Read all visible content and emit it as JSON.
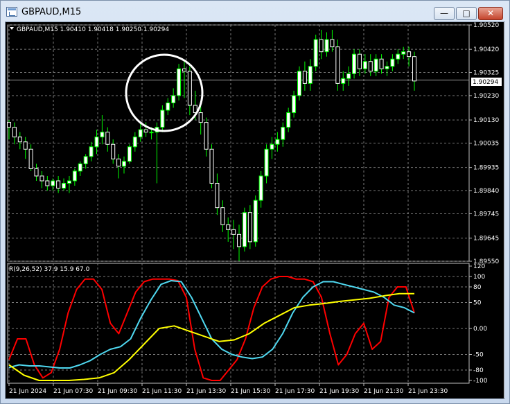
{
  "window": {
    "title": "GBPAUD,M15",
    "minimize": "—",
    "maximize": "□",
    "close": "✕"
  },
  "chart": {
    "info": "GBPAUD,M15  1.90410 1.90418 1.90250 1.90294",
    "current_price": "1.90294",
    "price_ticks": [
      "1.90520",
      "1.90420",
      "1.90325",
      "1.90230",
      "1.90130",
      "1.90035",
      "1.89935",
      "1.89840",
      "1.89745",
      "1.89645",
      "1.89550"
    ],
    "time_ticks": [
      "21 Jun 2024",
      "21 Jun 07:30",
      "21 Jun 09:30",
      "21 Jun 11:30",
      "21 Jun 13:30",
      "21 Jun 15:30",
      "21 Jun 17:30",
      "21 Jun 19:30",
      "21 Jun 21:30",
      "21 Jun 23:30"
    ],
    "indicator_label": "R(9,26,52) 37.9 15.9 67.0",
    "indicator_ticks": [
      "120",
      "100",
      "80",
      "50",
      "0.00",
      "-50",
      "-80",
      "-100"
    ],
    "colors": {
      "background": "#000000",
      "bull": "#ffffff",
      "bear": "#ffffff",
      "wick": "#00ff00",
      "grid": "#7a7a7a",
      "red": "#ff0000",
      "cyan": "#4fd8f0",
      "yellow": "#ffff00",
      "annotation": "#ffffff"
    }
  },
  "chart_data": [
    {
      "type": "candlestick",
      "title": "GBPAUD,M15",
      "ylim": [
        1.8955,
        1.9052
      ],
      "series": [
        {
          "name": "GBPAUD",
          "ohlc": [
            [
              1.9012,
              1.9013,
              1.9005,
              1.901
            ],
            [
              1.901,
              1.9012,
              1.9003,
              1.9006
            ],
            [
              1.9006,
              1.9008,
              1.9001,
              1.9004
            ],
            [
              1.9004,
              1.9006,
              1.8997,
              1.9001
            ],
            [
              1.9001,
              1.9003,
              1.8992,
              1.8993
            ],
            [
              1.8993,
              1.8995,
              1.8988,
              1.899
            ],
            [
              1.899,
              1.8992,
              1.8985,
              1.8988
            ],
            [
              1.8988,
              1.899,
              1.8984,
              1.8986
            ],
            [
              1.8986,
              1.8989,
              1.8984,
              1.8988
            ],
            [
              1.8988,
              1.899,
              1.8983,
              1.8985
            ],
            [
              1.8985,
              1.8989,
              1.8984,
              1.8987
            ],
            [
              1.8987,
              1.899,
              1.8983,
              1.8988
            ],
            [
              1.8988,
              1.8993,
              1.8986,
              1.8992
            ],
            [
              1.8992,
              1.8996,
              1.899,
              1.8995
            ],
            [
              1.8995,
              1.8999,
              1.8993,
              1.8998
            ],
            [
              1.8998,
              1.9004,
              1.8996,
              1.9002
            ],
            [
              1.9002,
              1.9009,
              1.8999,
              1.9006
            ],
            [
              1.9006,
              1.9015,
              1.9003,
              1.9008
            ],
            [
              1.9008,
              1.901,
              1.9,
              1.9003
            ],
            [
              1.9003,
              1.9005,
              1.8995,
              1.8997
            ],
            [
              1.8997,
              1.8999,
              1.8989,
              1.8994
            ],
            [
              1.8994,
              1.8998,
              1.8991,
              1.8996
            ],
            [
              1.8996,
              1.9003,
              1.8995,
              1.9002
            ],
            [
              1.9002,
              1.9008,
              1.9,
              1.9006
            ],
            [
              1.9006,
              1.9012,
              1.9004,
              1.9009
            ],
            [
              1.9009,
              1.9012,
              1.9006,
              1.9008
            ],
            [
              1.9008,
              1.901,
              1.9005,
              1.9008
            ],
            [
              1.9008,
              1.9012,
              1.8987,
              1.901
            ],
            [
              1.901,
              1.9019,
              1.9008,
              1.9017
            ],
            [
              1.9017,
              1.9022,
              1.9015,
              1.902
            ],
            [
              1.902,
              1.9026,
              1.9018,
              1.9023
            ],
            [
              1.9023,
              1.9036,
              1.9021,
              1.9034
            ],
            [
              1.9034,
              1.9037,
              1.9022,
              1.9033
            ],
            [
              1.9033,
              1.9035,
              1.9015,
              1.9019
            ],
            [
              1.9019,
              1.9025,
              1.9013,
              1.9016
            ],
            [
              1.9016,
              1.9019,
              1.9007,
              1.9012
            ],
            [
              1.9012,
              1.9014,
              1.8998,
              1.9001
            ],
            [
              1.9001,
              1.9003,
              1.8985,
              1.8987
            ],
            [
              1.8987,
              1.8991,
              1.8974,
              1.8977
            ],
            [
              1.8977,
              1.898,
              1.8967,
              1.897
            ],
            [
              1.897,
              1.8973,
              1.8963,
              1.8968
            ],
            [
              1.8968,
              1.8972,
              1.896,
              1.8966
            ],
            [
              1.8966,
              1.897,
              1.8955,
              1.8961
            ],
            [
              1.8961,
              1.8977,
              1.8959,
              1.8975
            ],
            [
              1.8975,
              1.8978,
              1.896,
              1.8963
            ],
            [
              1.8963,
              1.8982,
              1.8961,
              1.898
            ],
            [
              1.898,
              1.8992,
              1.8977,
              1.899
            ],
            [
              1.899,
              1.9003,
              1.8987,
              1.9001
            ],
            [
              1.9001,
              1.9006,
              1.8997,
              1.9003
            ],
            [
              1.9003,
              1.9008,
              1.9,
              1.9005
            ],
            [
              1.9005,
              1.9012,
              1.9002,
              1.901
            ],
            [
              1.901,
              1.9018,
              1.9008,
              1.9016
            ],
            [
              1.9016,
              1.9025,
              1.9014,
              1.9023
            ],
            [
              1.9023,
              1.9035,
              1.9021,
              1.9033
            ],
            [
              1.9033,
              1.9037,
              1.9025,
              1.9028
            ],
            [
              1.9028,
              1.9038,
              1.9025,
              1.9035
            ],
            [
              1.9035,
              1.9048,
              1.9033,
              1.9046
            ],
            [
              1.9046,
              1.905,
              1.9038,
              1.9041
            ],
            [
              1.9041,
              1.9049,
              1.9039,
              1.9046
            ],
            [
              1.9046,
              1.905,
              1.9041,
              1.9043
            ],
            [
              1.9043,
              1.9046,
              1.9025,
              1.9028
            ],
            [
              1.9028,
              1.9033,
              1.9025,
              1.903
            ],
            [
              1.903,
              1.9035,
              1.9027,
              1.9032
            ],
            [
              1.9032,
              1.9042,
              1.903,
              1.904
            ],
            [
              1.904,
              1.9042,
              1.9031,
              1.9034
            ],
            [
              1.9034,
              1.904,
              1.9032,
              1.9037
            ],
            [
              1.9037,
              1.904,
              1.9031,
              1.9033
            ],
            [
              1.9033,
              1.904,
              1.9031,
              1.9038
            ],
            [
              1.9038,
              1.904,
              1.9032,
              1.9034
            ],
            [
              1.9034,
              1.9037,
              1.9031,
              1.9035
            ],
            [
              1.9035,
              1.904,
              1.9033,
              1.9038
            ],
            [
              1.9038,
              1.9042,
              1.9036,
              1.904
            ],
            [
              1.904,
              1.9043,
              1.9038,
              1.9041
            ],
            [
              1.9041,
              1.9043,
              1.9035,
              1.9039
            ],
            [
              1.9039,
              1.9041,
              1.9025,
              1.9029
            ]
          ]
        }
      ]
    },
    {
      "type": "line",
      "title": "R(9,26,52) 37.9 15.9 67.0",
      "ylim": [
        -100,
        120
      ],
      "series": [
        {
          "name": "red",
          "values": [
            -60,
            -20,
            -20,
            -70,
            -95,
            -85,
            -40,
            30,
            75,
            95,
            95,
            75,
            10,
            -10,
            30,
            70,
            90,
            95,
            95,
            95,
            92,
            60,
            -40,
            -95,
            -100,
            -100,
            -80,
            -60,
            -20,
            40,
            80,
            95,
            100,
            100,
            95,
            95,
            90,
            60,
            -10,
            -70,
            -50,
            -10,
            10,
            -40,
            -25,
            60,
            80,
            80,
            30
          ]
        },
        {
          "name": "cyan",
          "values": [
            -75,
            -70,
            -72,
            -72,
            -74,
            -76,
            -76,
            -70,
            -62,
            -50,
            -40,
            -35,
            -20,
            20,
            55,
            85,
            92,
            90,
            60,
            20,
            -20,
            -40,
            -50,
            -55,
            -58,
            -55,
            -40,
            -10,
            30,
            60,
            80,
            90,
            90,
            85,
            80,
            75,
            70,
            60,
            45,
            40,
            30
          ]
        },
        {
          "name": "yellow",
          "values": [
            -70,
            -90,
            -100,
            -100,
            -100,
            -98,
            -95,
            -85,
            -60,
            -30,
            0,
            5,
            -5,
            -15,
            -25,
            -22,
            -10,
            10,
            25,
            40,
            45,
            48,
            52,
            55,
            58,
            63,
            67,
            67
          ]
        }
      ]
    }
  ]
}
